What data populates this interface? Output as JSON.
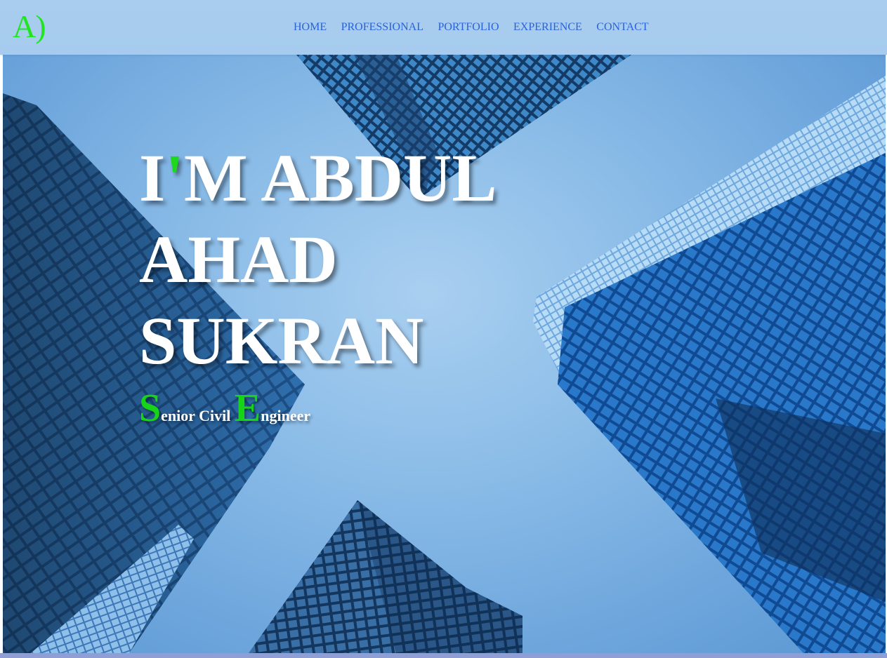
{
  "header": {
    "logo_text": "A)",
    "nav": [
      {
        "label": "HOME"
      },
      {
        "label": "PROFESSIONAL"
      },
      {
        "label": "PORTFOLIO"
      },
      {
        "label": "EXPERIENCE"
      },
      {
        "label": "CONTACT"
      }
    ]
  },
  "hero": {
    "title_line1_start": "I",
    "title_apostrophe": "'",
    "title_line1_end": "M ABDUL",
    "title_line2": "AHAD",
    "title_line3": "SUKRAN",
    "tagline": {
      "word1_initial": "S",
      "word1_rest": "enior Civil ",
      "word2_initial": "E",
      "word2_rest": "ngineer"
    },
    "background": "skyscrapers-looking-up-photo"
  },
  "colors": {
    "accent_green": "#1ed81e",
    "nav_link": "#2a62d8",
    "header_bg": "#a8cdee",
    "hero_text": "#ffffff"
  }
}
